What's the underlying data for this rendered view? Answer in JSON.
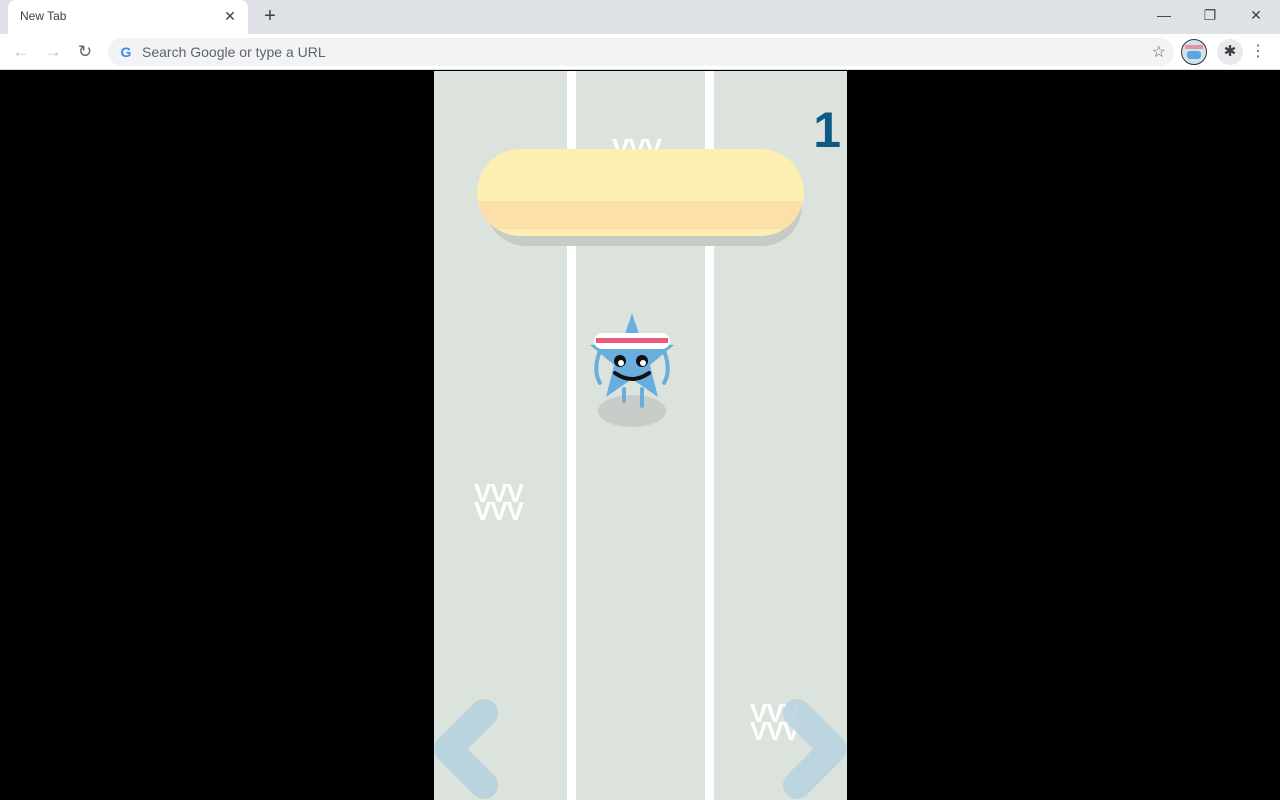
{
  "browser": {
    "tab_title": "New Tab",
    "tab_close_icon": "close-icon",
    "new_tab_icon": "plus-icon",
    "window_controls": {
      "minimize": "—",
      "restore": "❐",
      "close": "✕"
    },
    "nav": {
      "back": "←",
      "forward": "→",
      "reload": "↻"
    },
    "omnibox_placeholder": "Search Google or type a URL",
    "google_logo": "G",
    "bookmark_icon": "☆",
    "extensions_icon": "✱",
    "menu_icon": "⋮"
  },
  "game": {
    "score": "1",
    "lanes": 3,
    "player_lane": 2,
    "speed_marks": [
      {
        "text": "VVV"
      },
      {
        "text": "VVV\nVVV"
      },
      {
        "text": "VVV\nVVV"
      }
    ],
    "controls": {
      "left": "left-arrow",
      "right": "right-arrow"
    },
    "colors": {
      "track": "#dce3dc",
      "lane_line": "#ffffff",
      "score": "#0f5a84",
      "obstacle_top": "#fdeeb1",
      "obstacle_band": "#fddfaa",
      "player_body": "#6aaee0",
      "headband_stripe": "#ea5a7a",
      "arrow": "#b9d4df"
    }
  }
}
